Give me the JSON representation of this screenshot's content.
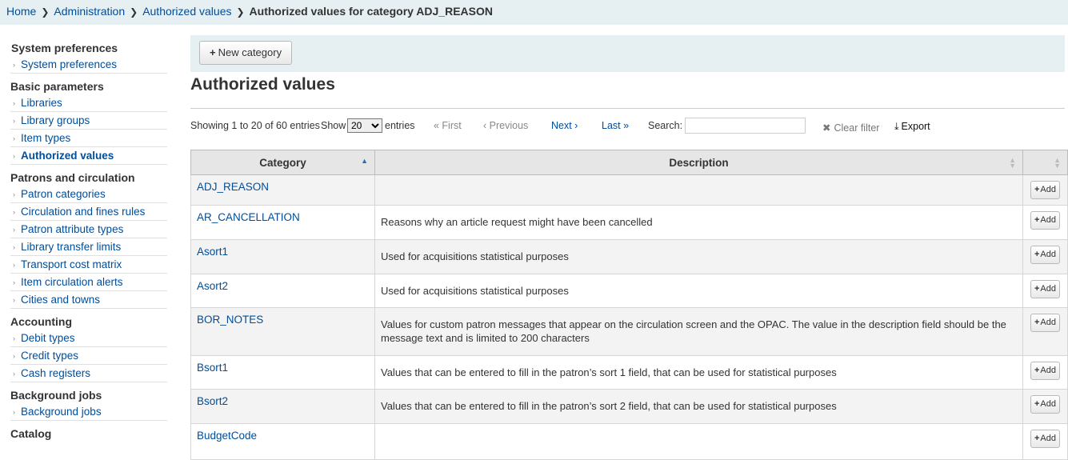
{
  "breadcrumb": {
    "items": [
      "Home",
      "Administration",
      "Authorized values"
    ],
    "current": "Authorized values for category ADJ_REASON"
  },
  "sidebar": {
    "sections": [
      {
        "title": "System preferences",
        "items": [
          "System preferences"
        ]
      },
      {
        "title": "Basic parameters",
        "items": [
          "Libraries",
          "Library groups",
          "Item types",
          "Authorized values"
        ]
      },
      {
        "title": "Patrons and circulation",
        "items": [
          "Patron categories",
          "Circulation and fines rules",
          "Patron attribute types",
          "Library transfer limits",
          "Transport cost matrix",
          "Item circulation alerts",
          "Cities and towns"
        ]
      },
      {
        "title": "Accounting",
        "items": [
          "Debit types",
          "Credit types",
          "Cash registers"
        ]
      },
      {
        "title": "Background jobs",
        "items": [
          "Background jobs"
        ]
      },
      {
        "title": "Catalog",
        "items": []
      }
    ],
    "active_item": "Authorized values"
  },
  "toolbar": {
    "new_category_label": "New category"
  },
  "page_title": "Authorized values",
  "table_controls": {
    "info": "Showing 1 to 20 of 60 entries",
    "show_label": "Show",
    "page_size": "20",
    "entries_label": "entries",
    "first": "« First",
    "previous": "‹ Previous",
    "next": "Next ›",
    "last": "Last »",
    "search_label": "Search:",
    "search_value": "",
    "clear_filter": "Clear filter",
    "export": "Export"
  },
  "table": {
    "columns": [
      "Category",
      "Description",
      ""
    ],
    "add_label": "Add",
    "rows": [
      {
        "category": "ADJ_REASON",
        "description": ""
      },
      {
        "category": "AR_CANCELLATION",
        "description": "Reasons why an article request might have been cancelled"
      },
      {
        "category": "Asort1",
        "description": "Used for acquisitions statistical purposes"
      },
      {
        "category": "Asort2",
        "description": "Used for acquisitions statistical purposes"
      },
      {
        "category": "BOR_NOTES",
        "description": "Values for custom patron messages that appear on the circulation screen and the OPAC. The value in the description field should be the message text and is limited to 200 characters"
      },
      {
        "category": "Bsort1",
        "description": "Values that can be entered to fill in the patron’s sort 1 field, that can be used for statistical purposes"
      },
      {
        "category": "Bsort2",
        "description": "Values that can be entered to fill in the patron’s sort 2 field, that can be used for statistical purposes"
      },
      {
        "category": "BudgetCode",
        "description": ""
      }
    ]
  },
  "colors": {
    "link": "#004d99",
    "header_bg": "#e6f0f2",
    "accent": "#2a6db7"
  }
}
